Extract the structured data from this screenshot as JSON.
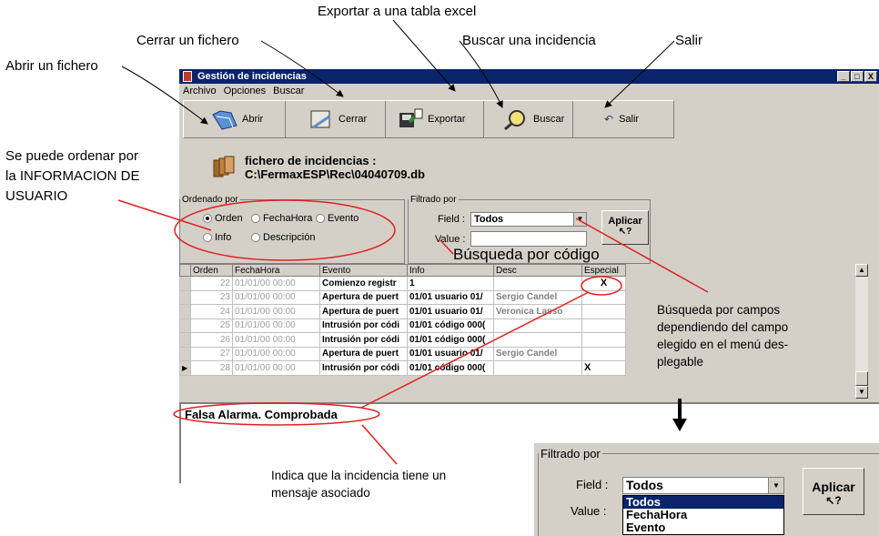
{
  "callouts": {
    "exportar": "Exportar a una tabla excel",
    "cerrar": "Cerrar un fichero",
    "buscar": "Buscar una incidencia",
    "salir": "Salir",
    "abrir": "Abrir un fichero",
    "ordenar_1": "Se puede ordenar por",
    "ordenar_2": "la INFORMACION DE",
    "ordenar_3": "USUARIO",
    "busqueda_codigo": "Búsqueda por código",
    "busqueda_campos_1": "Búsqueda por campos",
    "busqueda_campos_2": "dependiendo del campo",
    "busqueda_campos_3": "elegido en el menú des-",
    "busqueda_campos_4": "plegable",
    "mensaje_1": "Indica que la incidencia tiene un",
    "mensaje_2": "mensaje asociado"
  },
  "window": {
    "title": "Gestión de incidencias",
    "controls": [
      "_",
      "□",
      "X"
    ]
  },
  "menu": [
    "Archivo",
    "Opciones",
    "Buscar"
  ],
  "toolbar": {
    "abrir": "Abrir",
    "cerrar": "Cerrar",
    "exportar": "Exportar",
    "buscar": "Buscar",
    "salir": "Salir"
  },
  "file": {
    "label": "fichero de incidencias :",
    "path": "C:\\FermaxESP\\Rec\\04040709.db"
  },
  "order": {
    "legend": "Ordenado por",
    "options": [
      "Orden",
      "FechaHora",
      "Evento",
      "Info",
      "Descripción"
    ],
    "selected": "Orden"
  },
  "filter": {
    "legend": "Filtrado por",
    "field_label": "Field :",
    "field_value": "Todos",
    "value_label": "Value :",
    "apply": "Aplicar"
  },
  "table": {
    "columns": [
      "Orden",
      "FechaHora",
      "Evento",
      "Info",
      "Desc",
      "Especial"
    ],
    "rows": [
      [
        "22",
        "01/01/00 00:00",
        "Comienzo registr",
        "1",
        "",
        "X"
      ],
      [
        "23",
        "01/01/00 00:00",
        "Apertura de puert",
        "01/01 usuario 01/",
        "Sergio Candel",
        ""
      ],
      [
        "24",
        "01/01/00 00:00",
        "Apertura de puert",
        "01/01 usuario 01/",
        "Veronica Lasso",
        ""
      ],
      [
        "25",
        "01/01/00 00:00",
        "Intrusión por códi",
        "01/01 código 000(",
        "",
        ""
      ],
      [
        "26",
        "01/01/00 00:00",
        "Intrusión por códi",
        "01/01 código 000(",
        "",
        ""
      ],
      [
        "27",
        "01/01/00 00:00",
        "Apertura de puert",
        "01/01 usuario 01/",
        "Sergio Candel",
        ""
      ],
      [
        "28",
        "01/01/00 00:00",
        "Intrusión por códi",
        "01/01 código 000(",
        "",
        "X"
      ]
    ]
  },
  "memo": {
    "text": "Falsa Alarma. Comprobada"
  },
  "popup": {
    "legend": "Filtrado por",
    "field_label": "Field :",
    "field_value": "Todos",
    "value_label": "Value :",
    "apply": "Aplicar",
    "options": [
      "Todos",
      "FechaHora",
      "Evento"
    ]
  },
  "colors": {
    "titlebar": "#0a246a",
    "annotation": "#e02020",
    "window": "#d4d0c8"
  }
}
